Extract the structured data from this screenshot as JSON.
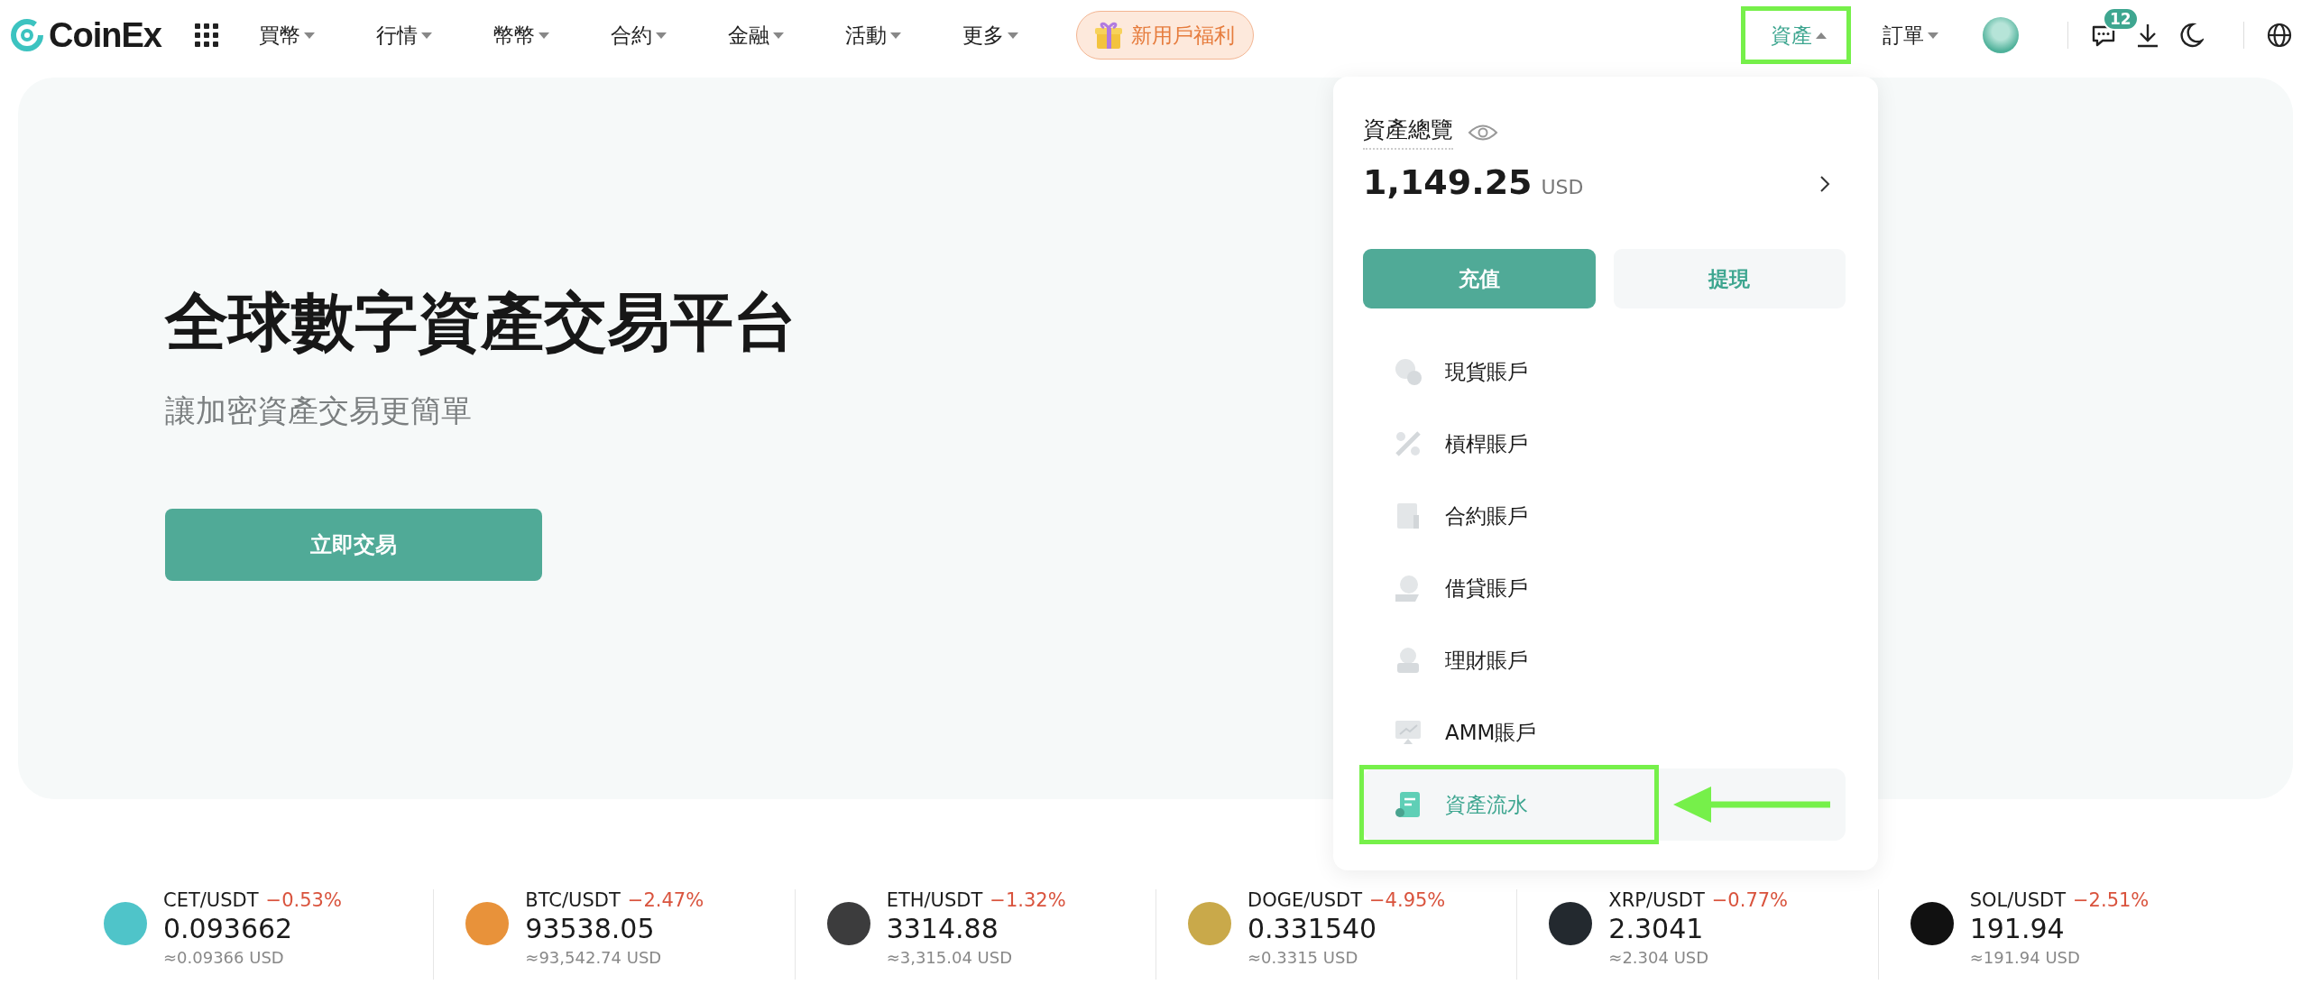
{
  "logo": "CoinEx",
  "nav": [
    {
      "label": "買幣"
    },
    {
      "label": "行情"
    },
    {
      "label": "幣幣"
    },
    {
      "label": "合約"
    },
    {
      "label": "金融"
    },
    {
      "label": "活動"
    },
    {
      "label": "更多"
    }
  ],
  "promo": "新用戶福利",
  "nav_right": [
    {
      "label": "資產",
      "expanded": true,
      "highlighted": true
    },
    {
      "label": "訂單",
      "expanded": false,
      "highlighted": false
    }
  ],
  "messages_badge": "12",
  "hero": {
    "title": "全球數字資產交易平台",
    "subtitle": "讓加密資產交易更簡單",
    "button": "立即交易"
  },
  "assets_menu": {
    "title": "資產總覽",
    "amount": "1,149.25",
    "currency": "USD",
    "deposit": "充值",
    "withdraw": "提現",
    "items": [
      {
        "kind": "spot",
        "label": "現貨賬戶",
        "selected": false,
        "highlighted": false
      },
      {
        "kind": "margin",
        "label": "槓桿賬戶",
        "selected": false,
        "highlighted": false
      },
      {
        "kind": "futures",
        "label": "合約賬戶",
        "selected": false,
        "highlighted": false
      },
      {
        "kind": "loan",
        "label": "借貸賬戶",
        "selected": false,
        "highlighted": false
      },
      {
        "kind": "finance",
        "label": "理財賬戶",
        "selected": false,
        "highlighted": false
      },
      {
        "kind": "amm",
        "label": "AMM賬戶",
        "selected": false,
        "highlighted": false
      },
      {
        "kind": "history",
        "label": "資產流水",
        "selected": true,
        "highlighted": true
      }
    ]
  },
  "tickers": [
    {
      "pair": "CET/USDT",
      "change": "−0.53%",
      "price": "0.093662",
      "usd": "≈0.09366 USD",
      "color": "#4fc4c9"
    },
    {
      "pair": "BTC/USDT",
      "change": "−2.47%",
      "price": "93538.05",
      "usd": "≈93,542.74 USD",
      "color": "#e8923a"
    },
    {
      "pair": "ETH/USDT",
      "change": "−1.32%",
      "price": "3314.88",
      "usd": "≈3,315.04 USD",
      "color": "#3c3c3d"
    },
    {
      "pair": "DOGE/USDT",
      "change": "−4.95%",
      "price": "0.331540",
      "usd": "≈0.3315 USD",
      "color": "#c9a94a"
    },
    {
      "pair": "XRP/USDT",
      "change": "−0.77%",
      "price": "2.3041",
      "usd": "≈2.304 USD",
      "color": "#23292f"
    },
    {
      "pair": "SOL/USDT",
      "change": "−2.51%",
      "price": "191.94",
      "usd": "≈191.94 USD",
      "color": "#111111"
    }
  ]
}
